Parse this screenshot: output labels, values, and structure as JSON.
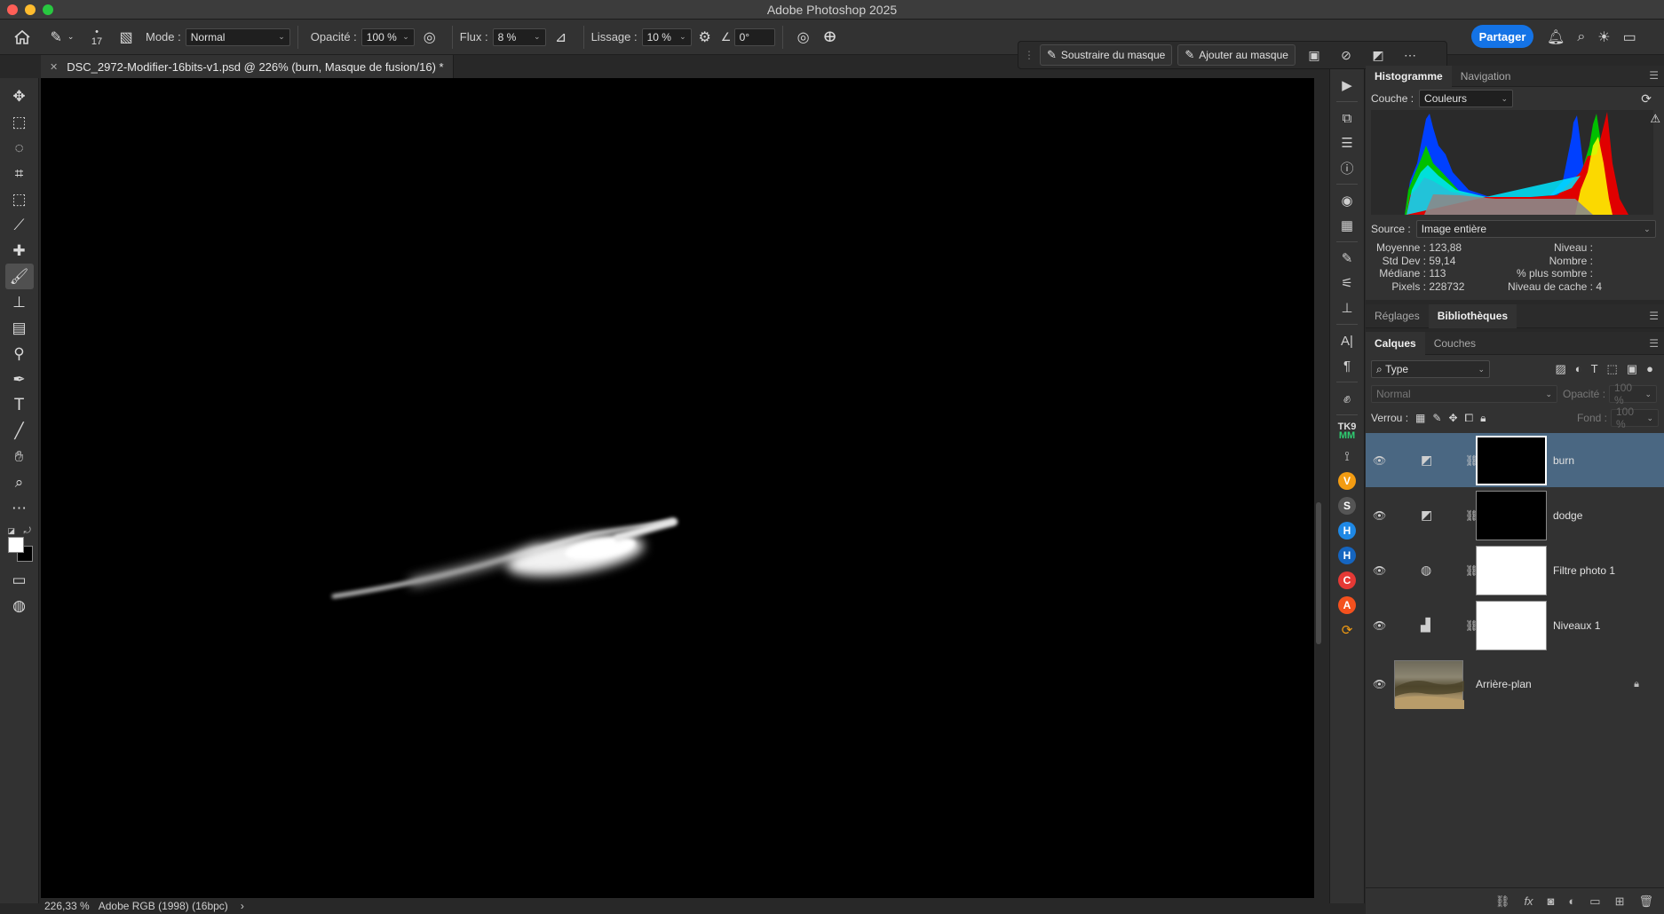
{
  "window": {
    "title": "Adobe Photoshop 2025"
  },
  "colors": {
    "accent": "#1473e6",
    "selected_layer": "#4a6782",
    "close": "#ff5f57",
    "minimize": "#febc2e",
    "zoom": "#28c840"
  },
  "options": {
    "brush_size": "17",
    "mode_label": "Mode :",
    "mode_value": "Normal",
    "opacity_label": "Opacité :",
    "opacity_value": "100 %",
    "flow_label": "Flux :",
    "flow_value": "8 %",
    "smoothing_label": "Lissage :",
    "smoothing_value": "10 %",
    "angle_value": "0°",
    "share_label": "Partager"
  },
  "document": {
    "tab_title": "DSC_2972-Modifier-16bits-v1.psd @ 226% (burn, Masque de fusion/16) *"
  },
  "taskbar": {
    "subtract_label": "Soustraire du masque",
    "add_label": "Ajouter au masque"
  },
  "status": {
    "zoom": "226,33 %",
    "profile": "Adobe RGB (1998) (16bpc)",
    "arrow": "›"
  },
  "histogram": {
    "tabs": [
      "Histogramme",
      "Navigation"
    ],
    "channel_label": "Couche :",
    "channel_value": "Couleurs",
    "source_label": "Source :",
    "source_value": "Image entière",
    "stats_left": [
      {
        "label": "Moyenne :",
        "value": "123,88"
      },
      {
        "label": "Std Dev :",
        "value": "59,14"
      },
      {
        "label": "Médiane :",
        "value": "113"
      },
      {
        "label": "Pixels :",
        "value": "228732"
      }
    ],
    "stats_right": [
      {
        "label": "Niveau :",
        "value": ""
      },
      {
        "label": "Nombre :",
        "value": ""
      },
      {
        "label": "% plus sombre :",
        "value": ""
      },
      {
        "label": "Niveau de cache :",
        "value": "4"
      }
    ]
  },
  "adjust_tabs": [
    "Réglages",
    "Bibliothèques"
  ],
  "layers_panel": {
    "tabs": [
      "Calques",
      "Couches"
    ],
    "filter_value": "Type",
    "blend_value": "Normal",
    "opacity_label": "Opacité :",
    "opacity_value": "100 %",
    "lock_label": "Verrou :",
    "fill_label": "Fond :",
    "fill_value": "100 %",
    "layers": [
      {
        "name": "burn",
        "mask": "black",
        "selected": true
      },
      {
        "name": "dodge",
        "mask": "black",
        "selected": false
      },
      {
        "name": "Filtre photo 1",
        "mask": "white",
        "selected": false
      },
      {
        "name": "Niveaux 1",
        "mask": "white",
        "selected": false
      },
      {
        "name": "Arrière-plan",
        "mask": "photo",
        "selected": false
      }
    ]
  },
  "plugin_icons": [
    {
      "name": "v-plugin",
      "letter": "V",
      "color": "#f39c12"
    },
    {
      "name": "s-plugin",
      "letter": "S",
      "color": "#555555"
    },
    {
      "name": "h-plugin-1",
      "letter": "H",
      "color": "#1e88e5"
    },
    {
      "name": "h-plugin-2",
      "letter": "H",
      "color": "#1565c0"
    },
    {
      "name": "c-plugin",
      "letter": "C",
      "color": "#e53935"
    },
    {
      "name": "a-plugin",
      "letter": "A",
      "color": "#f4511e"
    }
  ],
  "tk_label": {
    "line1": "TK9",
    "line2": "MM"
  }
}
